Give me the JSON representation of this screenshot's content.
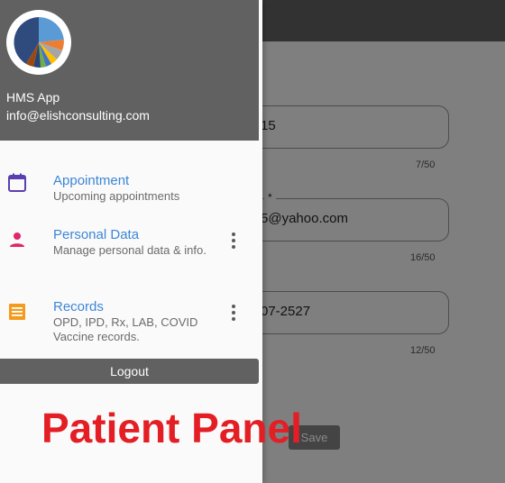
{
  "header": {
    "app_name": "HMS App",
    "email": "info@elishconsulting.com"
  },
  "menu": [
    {
      "title": "Appointment",
      "subtitle": "Upcoming appointments",
      "icon": "calendar-icon"
    },
    {
      "title": "Personal Data",
      "subtitle": "Manage personal data & info.",
      "icon": "person-icon"
    },
    {
      "title": "Records",
      "subtitle": "OPD, IPD, Rx, LAB, COVID Vaccine records.",
      "icon": "records-icon"
    }
  ],
  "logout_label": "Logout",
  "form": {
    "fields": [
      {
        "value": "15",
        "counter": "7/50"
      },
      {
        "value": "5@yahoo.com",
        "counter": "16/50",
        "required_mark": "*"
      },
      {
        "value": "07-2527",
        "counter": "12/50"
      }
    ],
    "save_label": "Save"
  },
  "overlay_label": "Patient Panel",
  "colors": {
    "title_blue": "#3d86d6",
    "calendar": "#5a3fb0",
    "person": "#e0276b",
    "records": "#f59b1c",
    "overlay_red": "#e31e24"
  }
}
